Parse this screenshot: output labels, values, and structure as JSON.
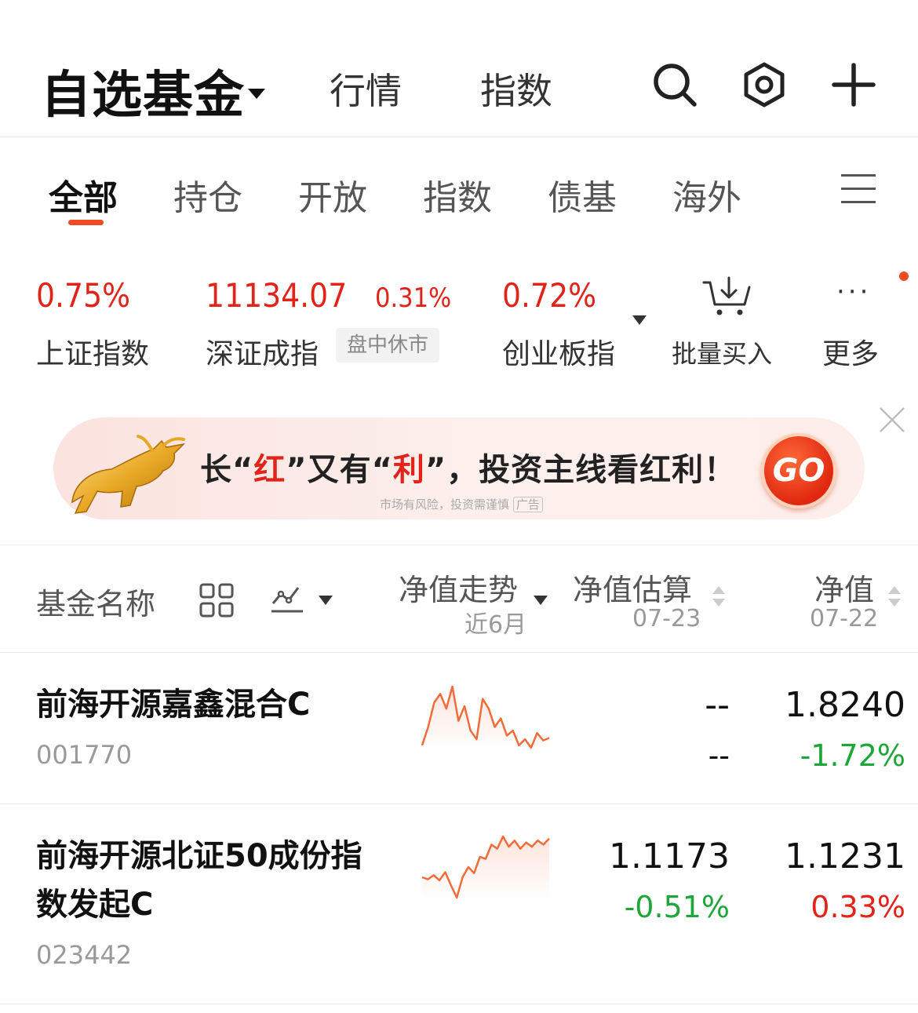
{
  "header": {
    "title": "自选基金",
    "tabs": [
      "行情",
      "指数"
    ],
    "icons": [
      "search-icon",
      "settings-hexagon-icon",
      "plus-icon"
    ]
  },
  "category_tabs": {
    "items": [
      "全部",
      "持仓",
      "开放",
      "指数",
      "债基",
      "海外"
    ],
    "active_index": 0
  },
  "indices": [
    {
      "value": "0.75%",
      "label": "上证指数",
      "color": "#e2231a"
    },
    {
      "value": "11134.07",
      "change": "0.31%",
      "label": "深证成指",
      "badge": "盘中休市",
      "color": "#e2231a"
    },
    {
      "value": "0.72%",
      "label": "创业板指",
      "color": "#e2231a"
    }
  ],
  "actions": {
    "batch_buy": "批量买入",
    "more_dots": "···",
    "more": "更多"
  },
  "banner": {
    "text_parts": [
      "长“",
      "红",
      "”又有“",
      "利",
      "”，投资主线看红利！"
    ],
    "disclaimer": "市场有风险，投资需谨慎",
    "ad_tag": "广告",
    "go": "GO"
  },
  "table_header": {
    "name": "基金名称",
    "trend": "净值走势",
    "trend_period": "近6月",
    "estimate": "净值估算",
    "estimate_date": "07-23",
    "nav": "净值",
    "nav_date": "07-22"
  },
  "funds": [
    {
      "name": "前海开源嘉鑫混合C",
      "code": "001770",
      "estimate": "--",
      "estimate_change": "--",
      "nav": "1.8240",
      "nav_change": "-1.72%",
      "nav_change_dir": "down",
      "estimate_change_dir": "flat",
      "trend": [
        40,
        55,
        75,
        82,
        70,
        88,
        60,
        72,
        52,
        45,
        78,
        70,
        55,
        62,
        48,
        52,
        40,
        45,
        38,
        50,
        44,
        46
      ]
    },
    {
      "name": "前海开源北证50成份指数发起C",
      "code": "023442",
      "estimate": "1.1173",
      "estimate_change": "-0.51%",
      "nav": "1.1231",
      "nav_change": "0.33%",
      "nav_change_dir": "up",
      "estimate_change_dir": "down",
      "trend": [
        30,
        28,
        32,
        27,
        35,
        22,
        10,
        30,
        40,
        34,
        50,
        48,
        62,
        58,
        70,
        60,
        66,
        58,
        64,
        60,
        66,
        62,
        68
      ]
    }
  ]
}
